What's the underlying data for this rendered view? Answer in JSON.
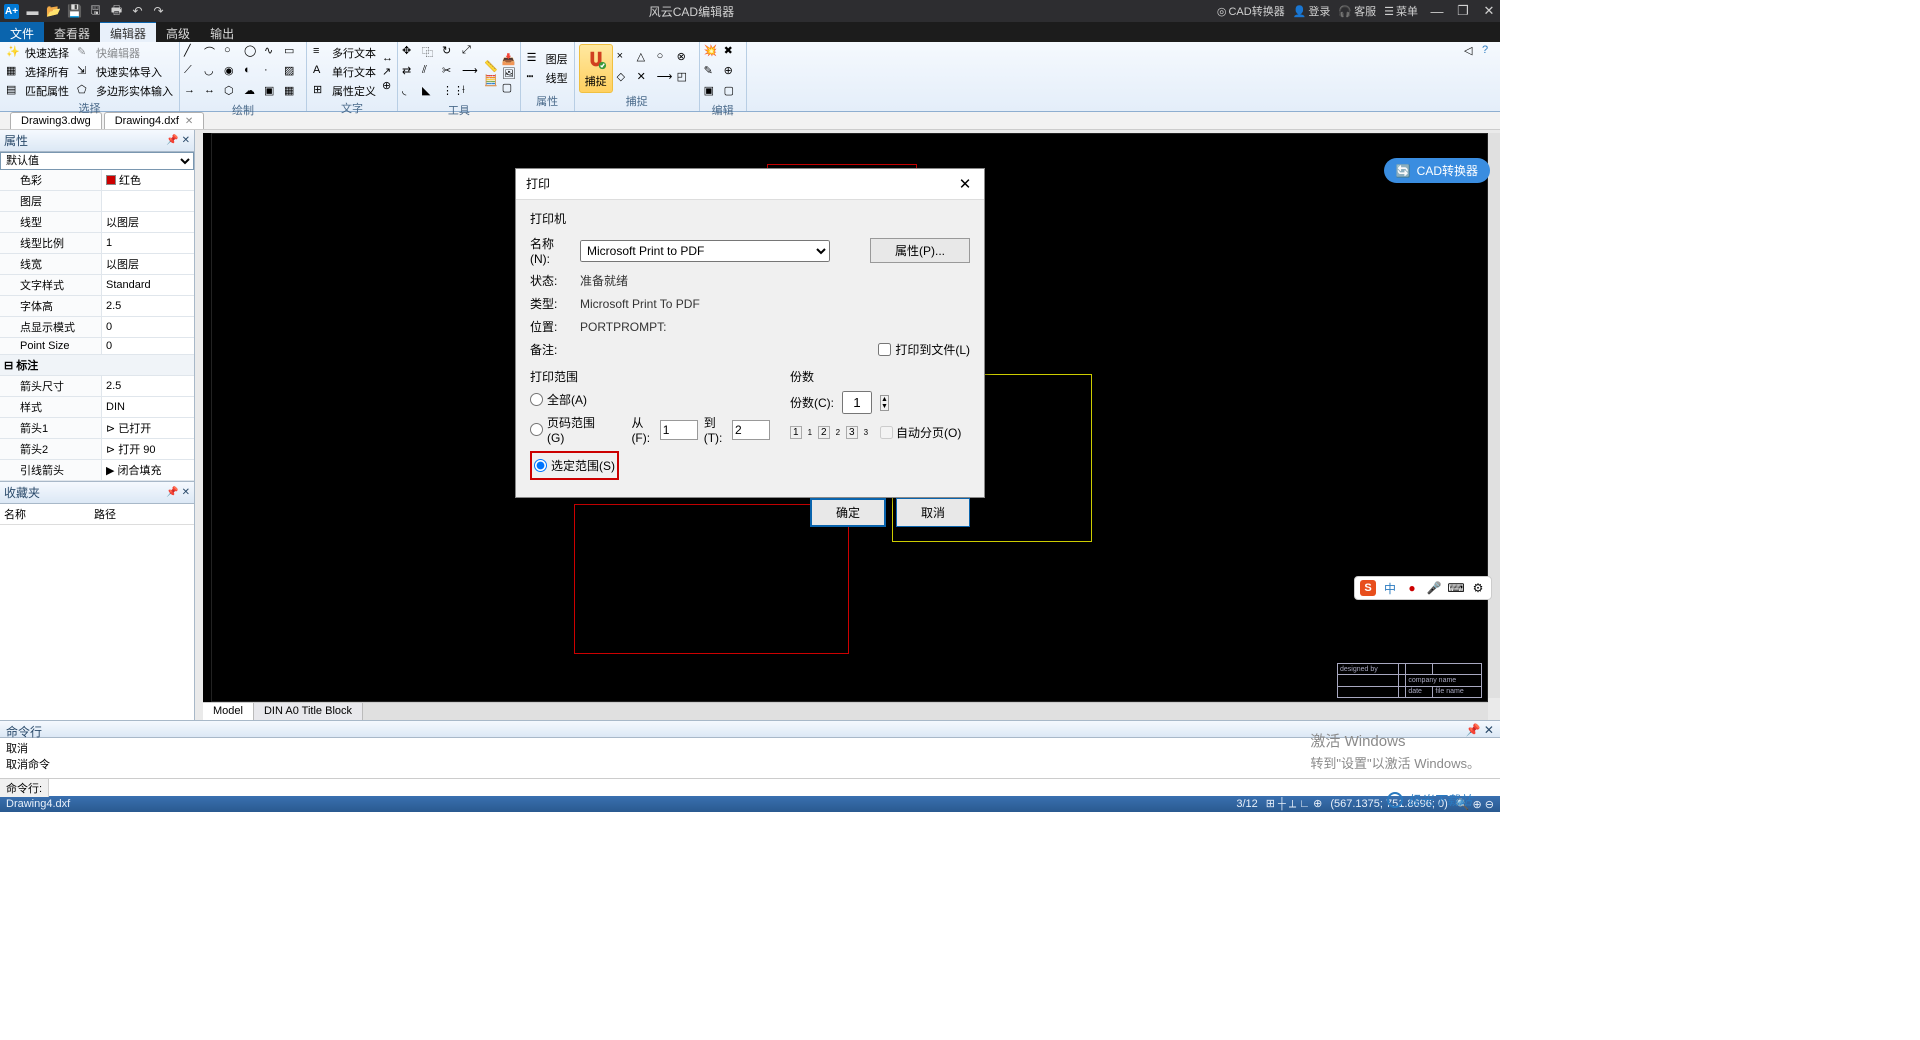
{
  "titlebar": {
    "app_title": "风云CAD编辑器",
    "cad_converter": "CAD转换器",
    "login": "登录",
    "support": "客服",
    "menu": "菜单"
  },
  "menu": {
    "file": "文件",
    "viewer": "查看器",
    "editor": "编辑器",
    "advanced": "高级",
    "output": "输出"
  },
  "ribbon": {
    "select": {
      "quick_select": "快速选择",
      "select_all": "选择所有",
      "match_prop": "匹配属性",
      "quick_editor": "快编辑器",
      "quick_entity_import": "快速实体导入",
      "poly_entity_input": "多边形实体输入",
      "label": "选择"
    },
    "draw": {
      "label": "绘制"
    },
    "text": {
      "mtext": "多行文本",
      "stext": "单行文本",
      "attdef": "属性定义",
      "label": "文字"
    },
    "tool": {
      "label": "工具"
    },
    "layer": {
      "layer": "图层",
      "linetype": "线型",
      "label": "属性"
    },
    "capture": {
      "capture": "捕捉",
      "label": "捕捉"
    },
    "edit": {
      "label": "编辑"
    }
  },
  "doctabs": {
    "tab1": "Drawing3.dwg",
    "tab2": "Drawing4.dxf"
  },
  "props": {
    "title": "属性",
    "default_val": "默认值",
    "rows": {
      "color_k": "色彩",
      "color_v": "红色",
      "layer_k": "图层",
      "ltype_k": "线型",
      "ltype_v": "以图层",
      "ltscale_k": "线型比例",
      "ltscale_v": "1",
      "lweight_k": "线宽",
      "lweight_v": "以图层",
      "tstyle_k": "文字样式",
      "tstyle_v": "Standard",
      "theight_k": "字体高",
      "theight_v": "2.5",
      "pdmode_k": "点显示模式",
      "pdmode_v": "0",
      "psize_k": "Point Size",
      "psize_v": "0"
    },
    "annot_section": "标注",
    "annot": {
      "arrowsize_k": "箭头尺寸",
      "arrowsize_v": "2.5",
      "style_k": "样式",
      "style_v": "DIN",
      "arrow1_k": "箭头1",
      "arrow1_v": "已打开",
      "arrow2_k": "箭头2",
      "arrow2_v": "打开 90",
      "leader_k": "引线箭头",
      "leader_v": "闭合填充"
    }
  },
  "fav": {
    "title": "收藏夹",
    "name_col": "名称",
    "path_col": "路径"
  },
  "canvas_tabs": {
    "model": "Model",
    "layout1": "DIN A0 Title Block"
  },
  "titleblock": {
    "designed": "designed by",
    "company": "company name",
    "date": "date",
    "filename": "file name"
  },
  "cad_conv_btn": "CAD转换器",
  "cmd": {
    "title": "命令行",
    "line1": "取消",
    "line2": "取消命令",
    "prompt": "命令行:"
  },
  "status": {
    "file": "Drawing4.dxf",
    "pages": "3/12",
    "coords": "(567.1375; 751.8696; 0)"
  },
  "dialog": {
    "title": "打印",
    "printer_section": "打印机",
    "name_lbl": "名称(N):",
    "name_val": "Microsoft Print to PDF",
    "prop_btn": "属性(P)...",
    "status_lbl": "状态:",
    "status_val": "准备就绪",
    "type_lbl": "类型:",
    "type_val": "Microsoft Print To PDF",
    "loc_lbl": "位置:",
    "loc_val": "PORTPROMPT:",
    "remark_lbl": "备注:",
    "print_file": "打印到文件(L)",
    "range_section": "打印范围",
    "all": "全部(A)",
    "pages": "页码范围(G)",
    "from_lbl": "从(F):",
    "from_val": "1",
    "to_lbl": "到(T):",
    "to_val": "2",
    "selection": "选定范围(S)",
    "copies_section": "份数",
    "copies_lbl": "份数(C):",
    "copies_val": "1",
    "collate": "自动分页(O)",
    "ok": "确定",
    "cancel": "取消"
  },
  "ime": {
    "zh": "中"
  },
  "watermark": {
    "l1": "激活 Windows",
    "l2": "转到\"设置\"以激活 Windows。"
  },
  "logo_wm": "极光下载站"
}
